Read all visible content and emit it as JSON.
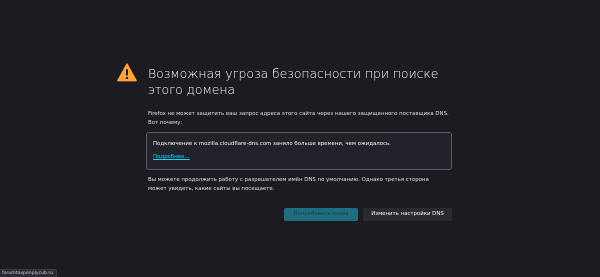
{
  "error_page": {
    "icon": "warning-triangle-icon",
    "title": "Возможная угроза безопасности при поиске этого домена",
    "description": "Firefox не может защитить ваш запрос адреса этого сайта через нашего защищенного поставщика DNS. Вот почему:",
    "details": {
      "message": "Подключение к mozilla.cloudflare-dns.com заняло больше времени, чем ожидалось.",
      "link_label": "Подробнее…"
    },
    "info": "Вы можете продолжить работу с разрешателем имён DNS по умолчанию. Однако третья сторона может увидеть, какие сайты вы посещаете.",
    "buttons": {
      "retry_label": "Попробовать снова",
      "settings_label": "Изменить настройки DNS"
    }
  },
  "status_bar": {
    "url": "forumtaxpenplycub.ru"
  },
  "colors": {
    "background": "#1c1b22",
    "warning": "#ffa436",
    "link": "#00ddff",
    "primary_button": "#1f6e7f"
  }
}
